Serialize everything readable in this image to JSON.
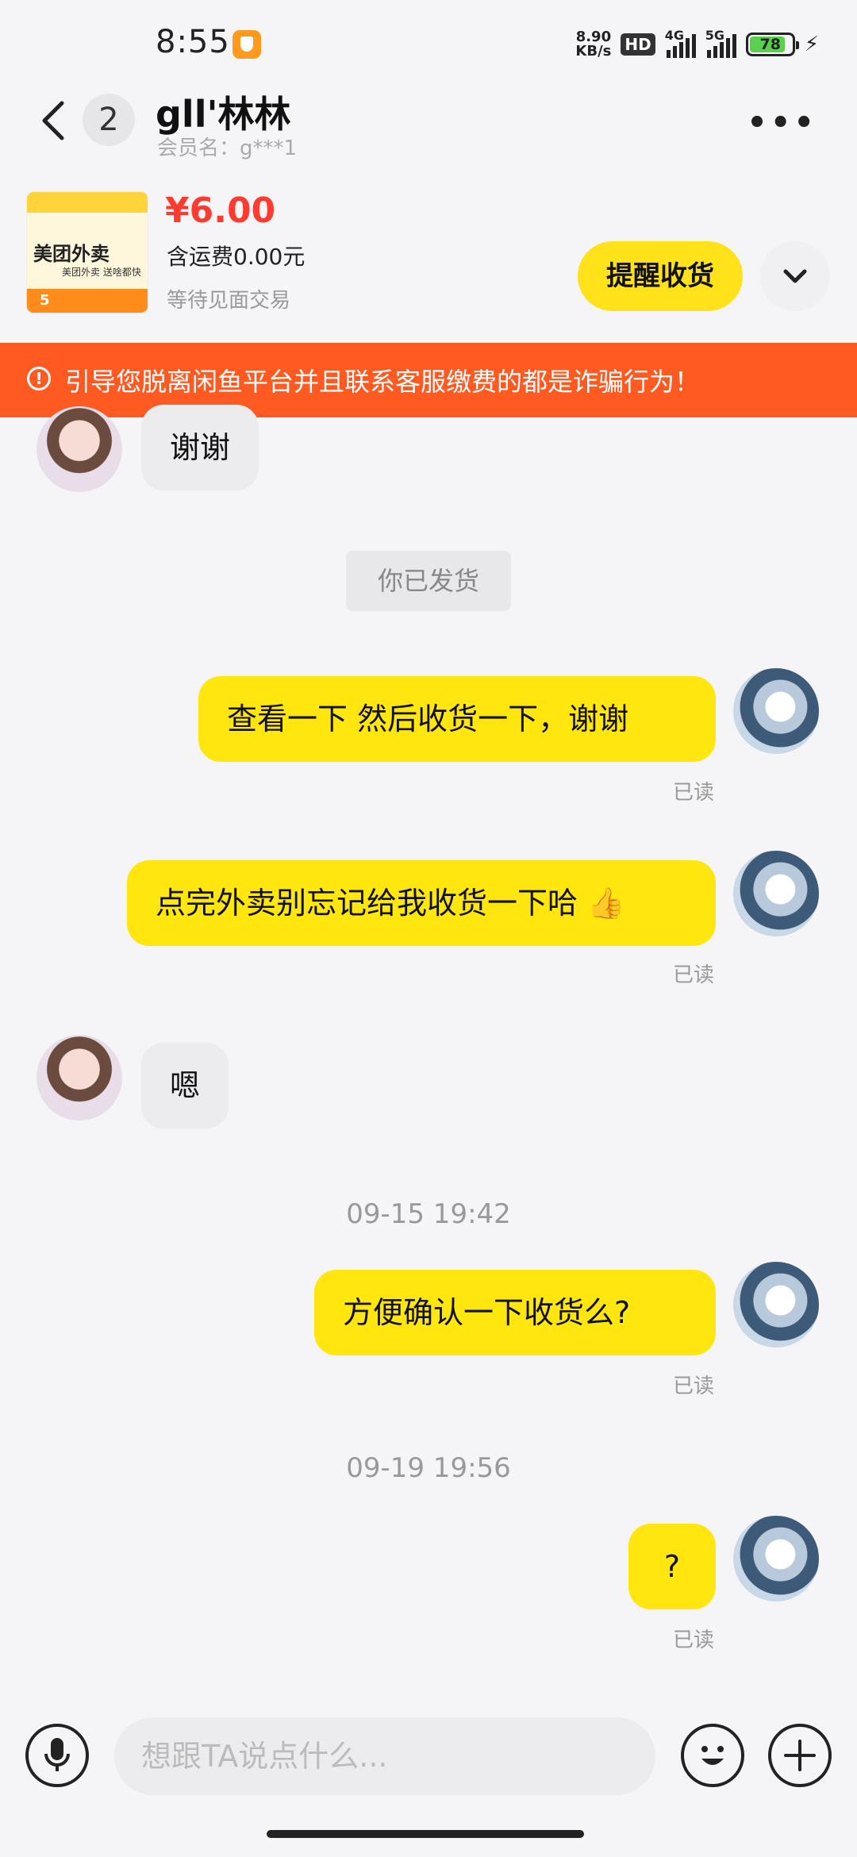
{
  "status_bar": {
    "time": "8:55",
    "net_speed_value": "8.90",
    "net_speed_unit": "KB/s",
    "hd": "HD",
    "signal1": "4G",
    "signal2": "5G",
    "battery": "78"
  },
  "header": {
    "unread": "2",
    "title": "gll'林林",
    "member": "会员名：g***1"
  },
  "order": {
    "thumb_brand": "美团外卖",
    "thumb_slogan": "美团外卖 送啥都快",
    "thumb_num": "5",
    "price": "¥6.00",
    "shipping": "含运费0.00元",
    "status": "等待见面交易",
    "remind_button": "提醒收货"
  },
  "warning": "引导您脱离闲鱼平台并且联系客服缴费的都是诈骗行为！",
  "messages": [
    {
      "from": "other",
      "text": "谢谢"
    },
    {
      "from": "system",
      "text": "你已发货"
    },
    {
      "from": "me",
      "text": "查看一下 然后收货一下，谢谢",
      "read": "已读"
    },
    {
      "from": "me",
      "text": "点完外卖别忘记给我收货一下哈",
      "read": "已读"
    },
    {
      "from": "other",
      "text": "嗯"
    },
    {
      "from": "time",
      "text": "09-15 19:42"
    },
    {
      "from": "me",
      "text": "方便确认一下收货么?",
      "read": "已读"
    },
    {
      "from": "time",
      "text": "09-19 19:56"
    },
    {
      "from": "me",
      "text": "?",
      "read": "已读"
    }
  ],
  "input": {
    "placeholder": "想跟TA说点什么..."
  },
  "icons": {
    "back": "chevron-left-icon",
    "more": "more-dots-icon",
    "expand": "chevron-down-icon",
    "voice": "microphone-icon",
    "emoji": "emoji-icon",
    "add": "plus-icon"
  },
  "colors": {
    "accent": "#ffe60f",
    "price": "#ff3b30",
    "warning_bg": "#ff5a22"
  }
}
